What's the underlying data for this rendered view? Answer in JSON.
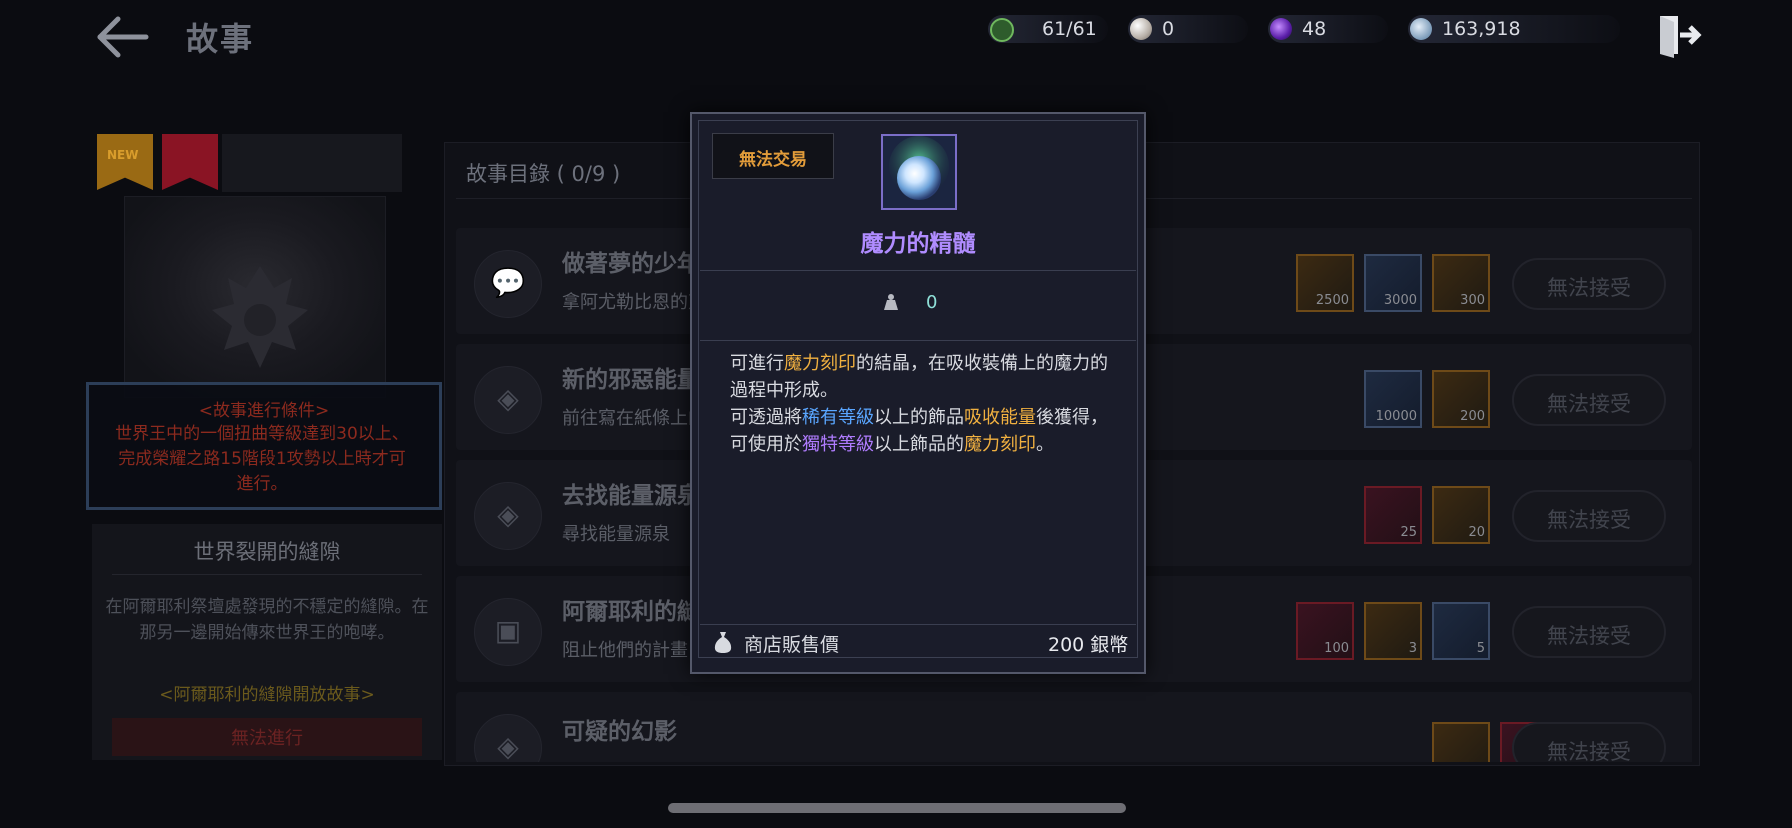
{
  "header": {
    "title": "故事",
    "currencies": [
      {
        "name": "stamina",
        "value": "61/61",
        "color": "#5fae5a"
      },
      {
        "name": "pearl",
        "value": "0",
        "color": "#c8c4c0"
      },
      {
        "name": "dark-orb",
        "value": "48",
        "color": "#7a3cc8"
      },
      {
        "name": "silver",
        "value": "163,918",
        "color": "#9bb8d8"
      }
    ]
  },
  "left_panel": {
    "badge_new": "NEW",
    "condition_title": "<故事進行條件>",
    "condition_text": "世界王中的一個扭曲等級達到30以上、完成榮耀之路15階段1攻勢以上時才可進行。",
    "world_title": "世界裂開的縫隙",
    "world_desc": "在阿爾耶利祭壇處發現的不穩定的縫隙。在那另一邊開始傳來世界王的咆哮。",
    "world_link": "<阿爾耶利的縫隙開放故事>",
    "world_button": "無法進行"
  },
  "catalog": {
    "title": "故事目錄 ( 0/9 )",
    "rows": [
      {
        "title": "做著夢的少年",
        "subtitle": "拿阿尤勒比恩的東西去找賽亞",
        "icon": "chat-icon",
        "rewards": [
          {
            "qty": "2500",
            "tier": "orange"
          },
          {
            "qty": "3000",
            "tier": "blue"
          },
          {
            "qty": "300",
            "tier": "orange"
          }
        ],
        "button": "無法接受"
      },
      {
        "title": "新的邪惡能量",
        "subtitle": "前往寫在紙條上的地點",
        "icon": "diamond-icon",
        "rewards": [
          {
            "qty": "10000",
            "tier": "blue"
          },
          {
            "qty": "200",
            "tier": "orange"
          }
        ],
        "button": "無法接受"
      },
      {
        "title": "去找能量源泉",
        "subtitle": "尋找能量源泉",
        "icon": "diamond-icon",
        "rewards": [
          {
            "qty": "25",
            "tier": "red"
          },
          {
            "qty": "20",
            "tier": "orange"
          }
        ],
        "button": "無法接受"
      },
      {
        "title": "阿爾耶利的縫隙",
        "subtitle": "阻止他們的計畫",
        "icon": "portal-icon",
        "rewards": [
          {
            "qty": "100",
            "tier": "red"
          },
          {
            "qty": "3",
            "tier": "orange"
          },
          {
            "qty": "5",
            "tier": "orange"
          }
        ],
        "button": "無法接受"
      },
      {
        "title": "可疑的幻影",
        "subtitle": "",
        "icon": "diamond-icon",
        "rewards": [
          {
            "qty": "",
            "tier": "orange"
          },
          {
            "qty": "",
            "tier": "red"
          }
        ],
        "button": "無法接受"
      }
    ]
  },
  "popup": {
    "trade_tag": "無法交易",
    "item_name": "魔力的精髓",
    "item_color": "#b08cff",
    "weight": "0",
    "desc_line1": [
      {
        "t": "可進行",
        "c": ""
      },
      {
        "t": "魔力刻印",
        "c": "orange"
      },
      {
        "t": "的結晶，在吸收裝備上的魔力的過程中形成。",
        "c": ""
      }
    ],
    "desc_line2": [
      {
        "t": "可透過將",
        "c": ""
      },
      {
        "t": "稀有等級",
        "c": "blue"
      },
      {
        "t": "以上的飾品",
        "c": ""
      },
      {
        "t": "吸收能量",
        "c": "orange"
      },
      {
        "t": "後獲得，可使用於",
        "c": ""
      },
      {
        "t": "獨特等級",
        "c": "purple"
      },
      {
        "t": "以上飾品的",
        "c": ""
      },
      {
        "t": "魔力刻印",
        "c": "orange"
      },
      {
        "t": "。",
        "c": ""
      }
    ],
    "sell_label": "商店販售價",
    "sell_price": "200 銀幣"
  }
}
